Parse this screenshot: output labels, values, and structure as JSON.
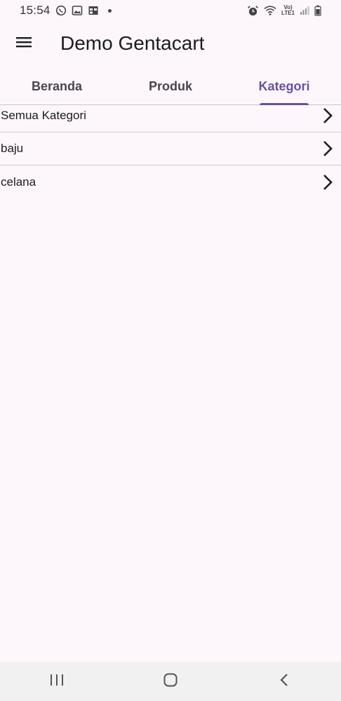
{
  "status_bar": {
    "time": "15:54",
    "left_icons": [
      "whatsapp-icon",
      "image-icon",
      "calendar-icon",
      "notification-dot-icon"
    ],
    "right_icons": [
      "alarm-icon",
      "wifi-icon",
      "volte-icon",
      "signal-icon",
      "battery-icon"
    ],
    "volte_top": "Vo)",
    "volte_bottom": "LTE1"
  },
  "app_bar": {
    "menu_icon": "hamburger-menu-icon",
    "title": "Demo Gentacart"
  },
  "tabs": [
    {
      "label": "Beranda",
      "active": false
    },
    {
      "label": "Produk",
      "active": false
    },
    {
      "label": "Kategori",
      "active": true
    }
  ],
  "categories": [
    {
      "label": "Semua Kategori",
      "icon": "chevron-right-icon"
    },
    {
      "label": "baju",
      "icon": "chevron-right-icon"
    },
    {
      "label": "celana",
      "icon": "chevron-right-icon"
    }
  ],
  "nav_bar": {
    "buttons": [
      "recent-apps-icon",
      "home-icon",
      "back-icon"
    ]
  },
  "colors": {
    "background": "#fdf7fc",
    "accent": "#6750a4",
    "text": "#1c1b1f",
    "tab_inactive": "#49454f",
    "divider": "#cac4d0",
    "nav_bar_bg": "#f1f1f1"
  }
}
